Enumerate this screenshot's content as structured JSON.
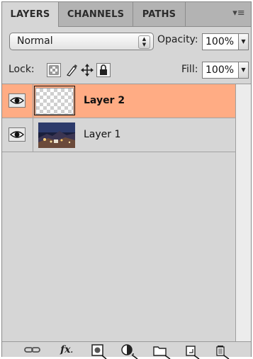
{
  "tabs": [
    {
      "label": "LAYERS",
      "active": true
    },
    {
      "label": "CHANNELS",
      "active": false
    },
    {
      "label": "PATHS",
      "active": false
    }
  ],
  "panel_menu_icon": "panel-menu-icon",
  "blend_mode": {
    "value": "Normal"
  },
  "opacity": {
    "label": "Opacity:",
    "value": "100%"
  },
  "lock": {
    "label": "Lock:",
    "icons": [
      "lock-transparent-pixels-icon",
      "lock-image-pixels-icon",
      "lock-position-icon",
      "lock-all-icon"
    ]
  },
  "fill": {
    "label": "Fill:",
    "value": "100%"
  },
  "layers": [
    {
      "name": "Layer 2",
      "selected": true,
      "visible": true,
      "thumbnail": "transparent"
    },
    {
      "name": "Layer 1",
      "selected": false,
      "visible": true,
      "thumbnail": "photo"
    }
  ],
  "colors": {
    "selection": "#ffac84",
    "panel": "#d6d6d6",
    "tabbar": "#b3b3b3"
  },
  "footer_icons": [
    "link-layers-icon",
    "fx-icon",
    "add-mask-icon",
    "adjustment-layer-icon",
    "new-group-icon",
    "new-layer-icon",
    "trash-icon"
  ],
  "footer": {
    "fx_label": "fx"
  }
}
